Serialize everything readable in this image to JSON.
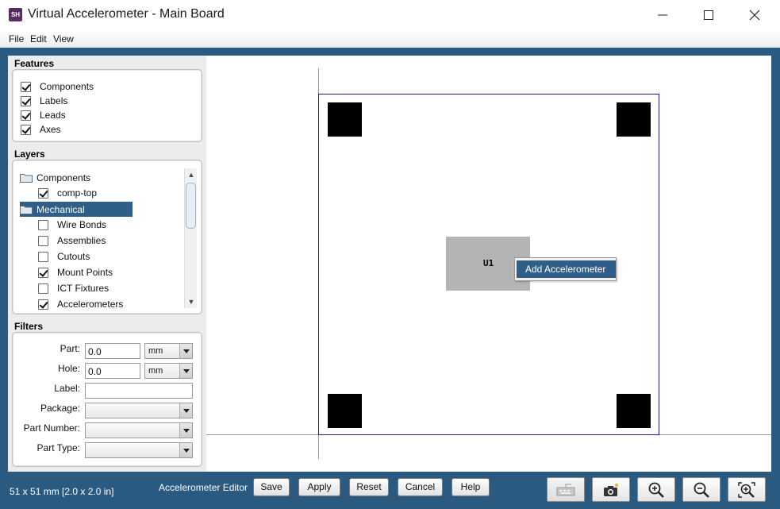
{
  "window": {
    "icon_text": "SH",
    "title": "Virtual Accelerometer - Main Board"
  },
  "menu": [
    "File",
    "Edit",
    "View"
  ],
  "features": {
    "title": "Features",
    "items": [
      {
        "label": "Components",
        "checked": true
      },
      {
        "label": "Labels",
        "checked": true
      },
      {
        "label": "Leads",
        "checked": true
      },
      {
        "label": "Axes",
        "checked": true
      }
    ]
  },
  "layers": {
    "title": "Layers",
    "items": [
      {
        "type": "folder",
        "label": "Components",
        "selected": false
      },
      {
        "type": "check",
        "label": "comp-top",
        "checked": true
      },
      {
        "type": "folder",
        "label": "Mechanical",
        "selected": true
      },
      {
        "type": "check",
        "label": "Wire Bonds",
        "checked": false
      },
      {
        "type": "check",
        "label": "Assemblies",
        "checked": false
      },
      {
        "type": "check",
        "label": "Cutouts",
        "checked": false
      },
      {
        "type": "check",
        "label": "Mount Points",
        "checked": true
      },
      {
        "type": "check",
        "label": "ICT Fixtures",
        "checked": false
      },
      {
        "type": "check",
        "label": "Accelerometers",
        "checked": true
      }
    ]
  },
  "filters": {
    "title": "Filters",
    "part_label": "Part:",
    "part_value": "0.0",
    "part_unit": "mm",
    "hole_label": "Hole:",
    "hole_value": "0.0",
    "hole_unit": "mm",
    "label_label": "Label:",
    "label_value": "",
    "package_label": "Package:",
    "package_value": "",
    "part_number_label": "Part Number:",
    "part_number_value": "",
    "part_type_label": "Part Type:",
    "part_type_value": ""
  },
  "canvas": {
    "component_label": "U1",
    "context_menu_item": "Add Accelerometer"
  },
  "bottom": {
    "size_text": "51 x 51 mm  [2.0 x 2.0 in]",
    "editor_label": "Accelerometer Editor",
    "buttons": {
      "save": "Save",
      "apply": "Apply",
      "reset": "Reset",
      "cancel": "Cancel",
      "help": "Help"
    }
  }
}
